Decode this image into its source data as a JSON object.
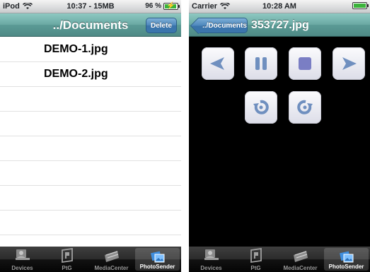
{
  "left": {
    "statusbar": {
      "carrier": "iPod",
      "time": "10:37 - 15MB",
      "battery": "96 %"
    },
    "navbar": {
      "title": "../Documents",
      "delete_label": "Delete"
    },
    "files": [
      "DEMO-1.jpg",
      "DEMO-2.jpg",
      "",
      "",
      "",
      "",
      "",
      "",
      ""
    ],
    "battery_level": 0.96
  },
  "right": {
    "statusbar": {
      "carrier": "Carrier",
      "time": "10:28 AM"
    },
    "navbar": {
      "back_label": "../Documents",
      "title": "353727.jpg"
    },
    "controls": [
      "previous-icon",
      "pause-icon",
      "stop-icon",
      "next-icon",
      "rotate-left-icon",
      "rotate-right-icon"
    ],
    "battery_level": 1.0
  },
  "tabs": [
    {
      "label": "Devices",
      "icon": "devices-icon"
    },
    {
      "label": "PtG",
      "icon": "ptg-icon"
    },
    {
      "label": "MediaCenter",
      "icon": "mediacenter-icon"
    },
    {
      "label": "PhotoSender",
      "icon": "photosender-icon",
      "selected": true
    }
  ],
  "colors": {
    "navbar": "#6aa9a3",
    "button": "#3b76ad",
    "tabbar": "#1a1a1a",
    "accent_battery": "#3bb33b"
  }
}
